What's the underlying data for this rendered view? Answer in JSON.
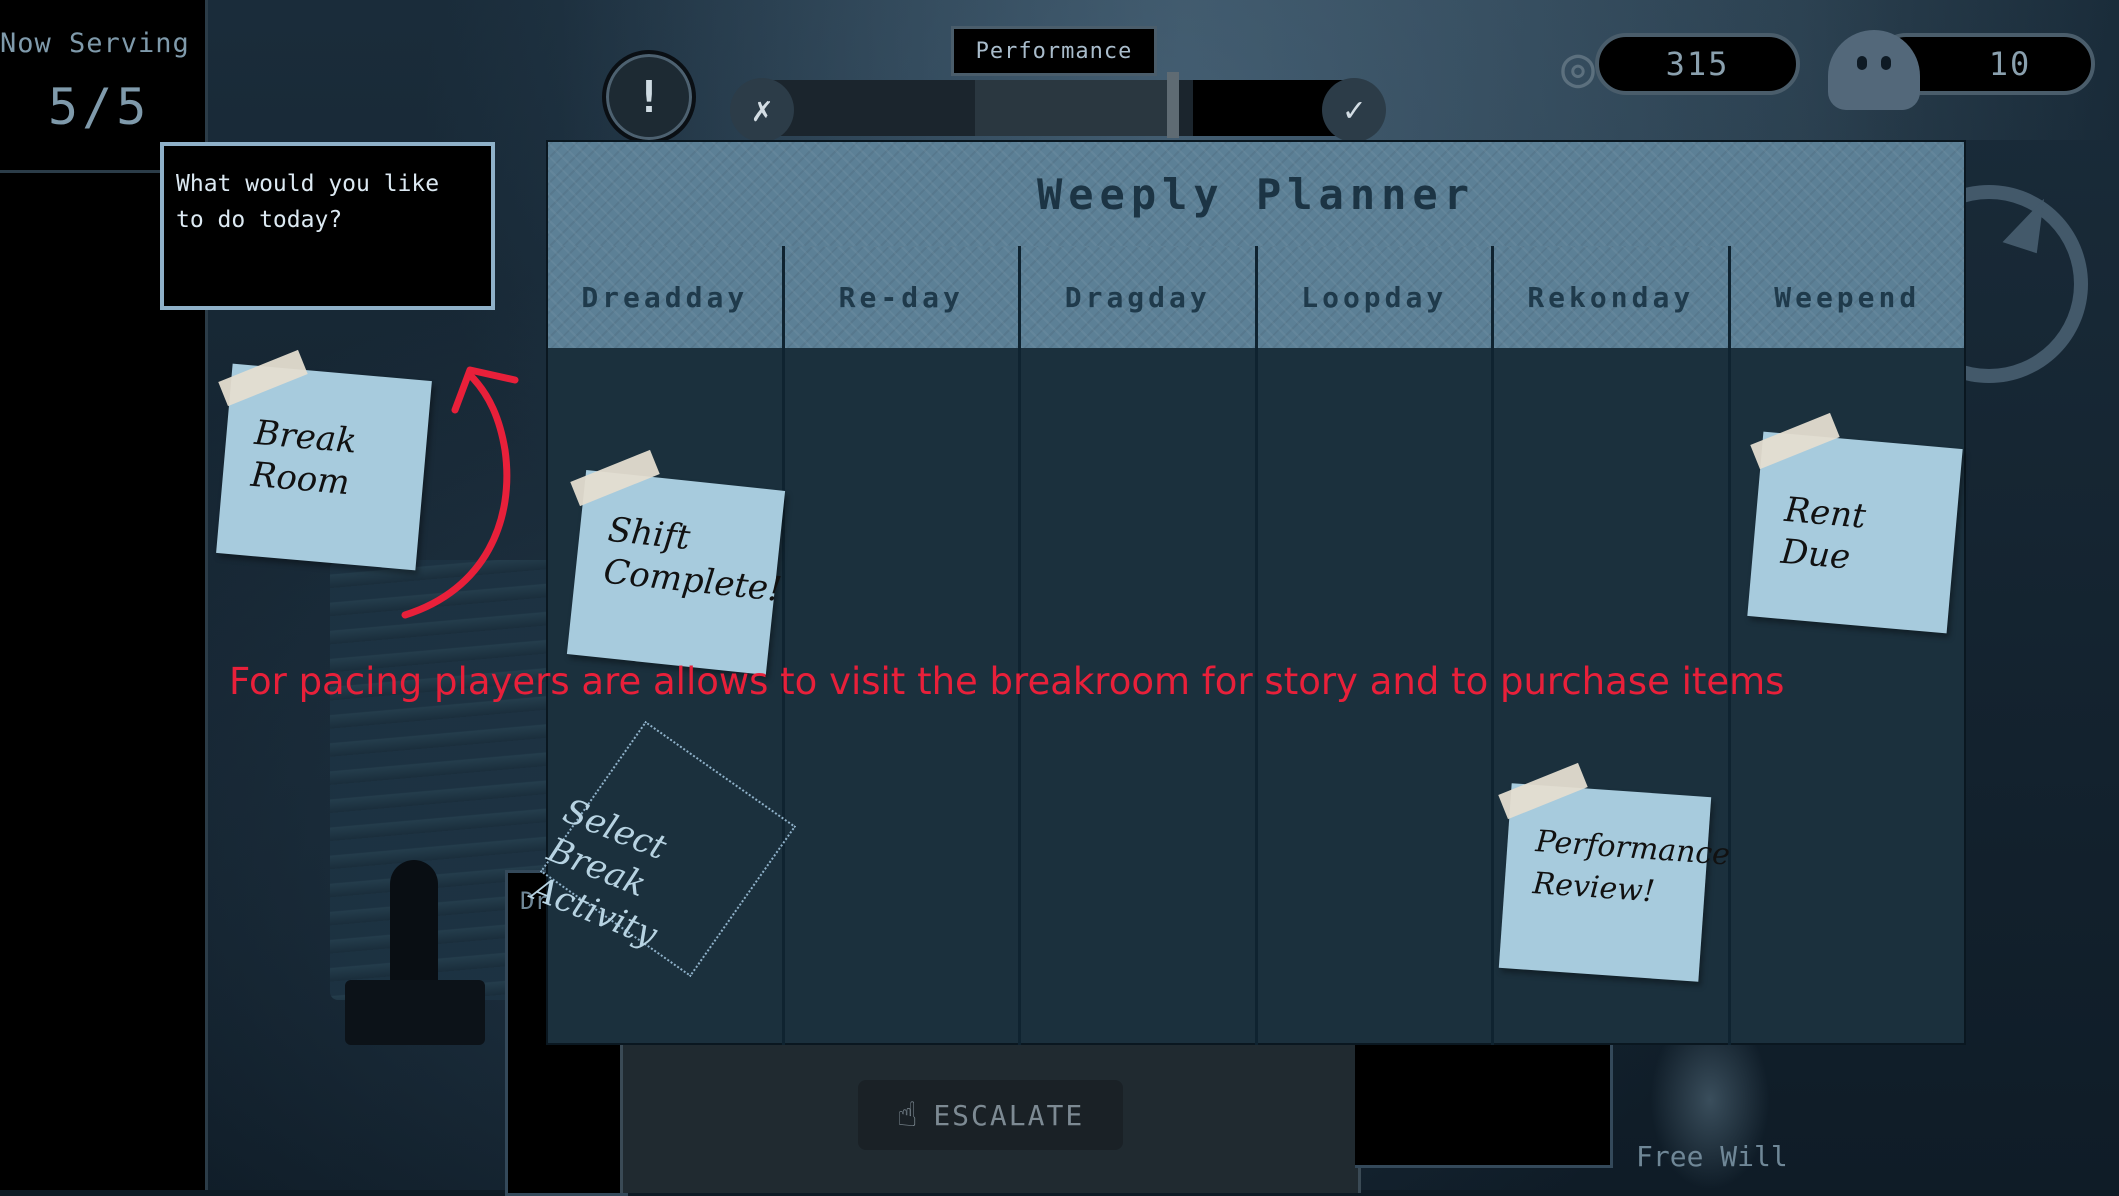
{
  "hud": {
    "now_serving_label": "Now Serving",
    "now_serving_value": "5/5",
    "performance_label": "Performance",
    "performance_level": 0.71,
    "coins": "315",
    "souls": "10"
  },
  "dialog": {
    "text": "What would you like to do today?"
  },
  "planner": {
    "title": "Weeply Planner",
    "days": [
      "Dreadday",
      "Re-day",
      "Dragday",
      "Loopday",
      "Rekonday",
      "Weepend"
    ]
  },
  "notes": {
    "break_room": "Break Room",
    "shift_complete": "Shift Complete!",
    "rent_due": "Rent Due",
    "performance_review": "Performance Review!",
    "select_break": "Select Break Activity"
  },
  "annotation": "For pacing players are allows to visit the breakroom for story and to purchase items",
  "desk": {
    "drawer_label": "Dr",
    "escalate_label": "ESCALATE",
    "free_will_label": "Free Will"
  },
  "icons": {
    "alert": "alert-head-icon",
    "perf_left": "sad-figure-icon",
    "perf_right": "happy-figure-icon",
    "coins": "coin-stack-icon",
    "souls": "ghost-icon",
    "escalate": "pointing-hand-icon"
  },
  "colors": {
    "annotation": "#e8203a",
    "sticky": "#a7cbdd",
    "planner_header": "#5c8096"
  }
}
